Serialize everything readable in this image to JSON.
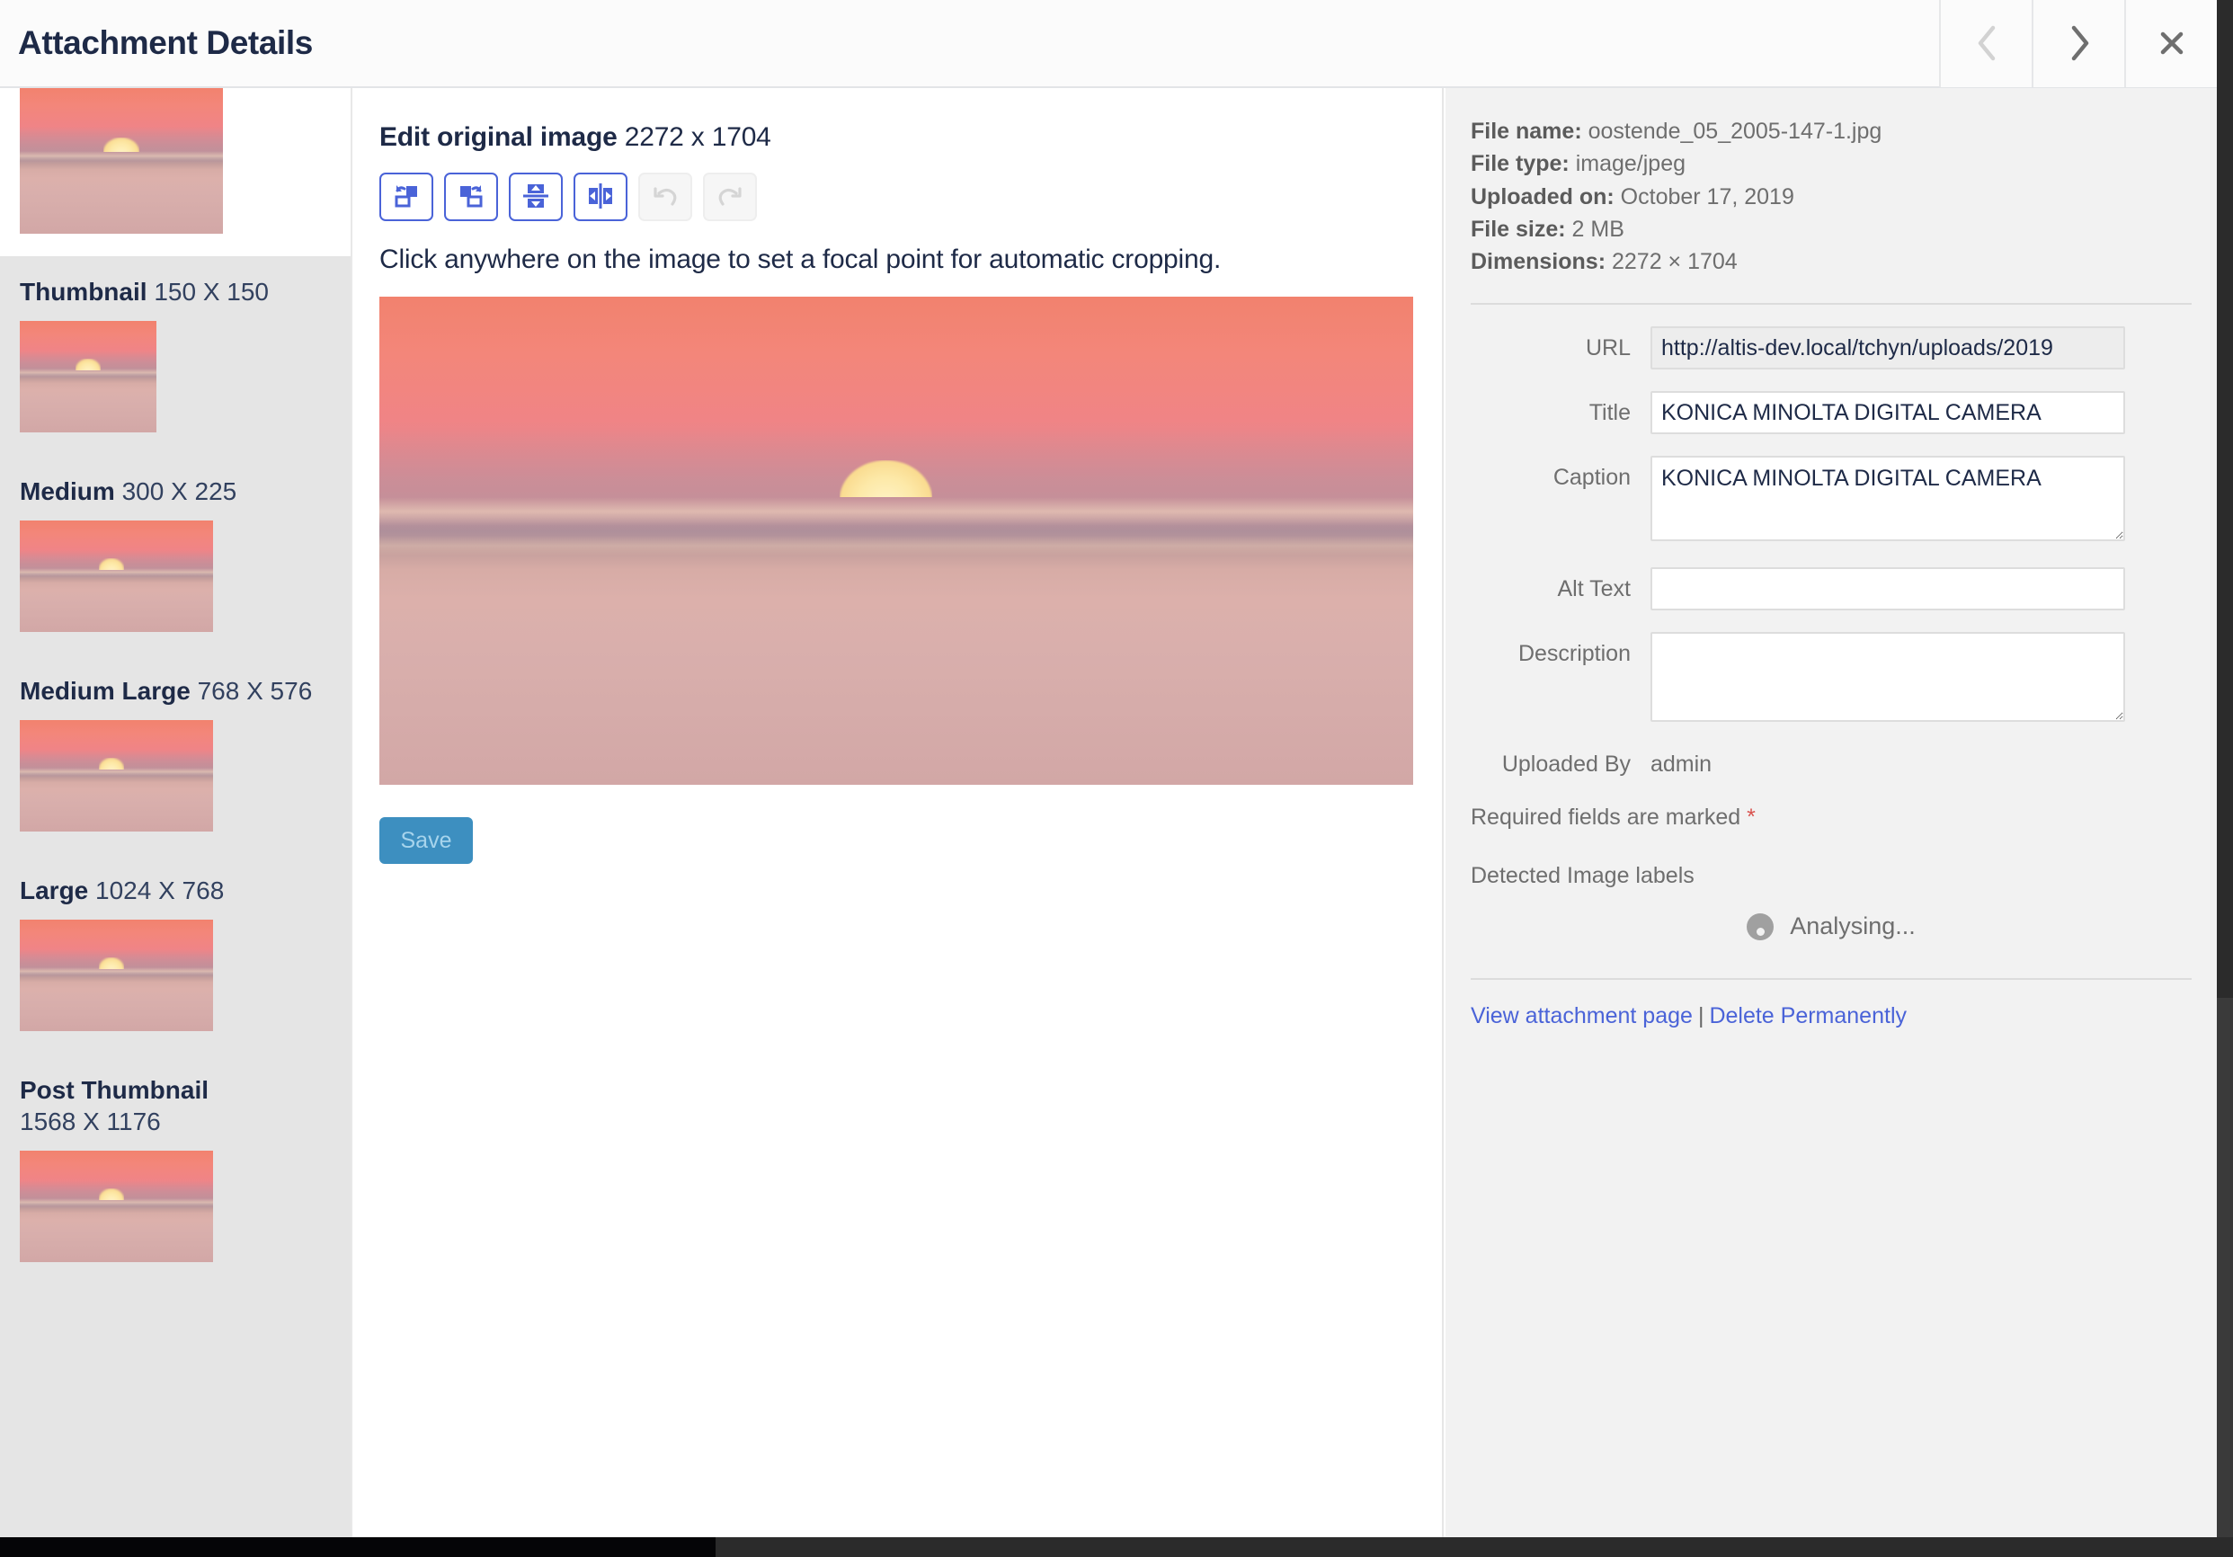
{
  "header": {
    "title": "Attachment Details",
    "prev_label": "Previous",
    "next_label": "Next",
    "close_label": "Close"
  },
  "sizes_sidebar": {
    "items": [
      {
        "name": "Thumbnail",
        "dimensions": "150 X 150",
        "wrap": false
      },
      {
        "name": "Medium",
        "dimensions": "300 X 225",
        "wrap": false
      },
      {
        "name": "Medium Large",
        "dimensions": "768 X 576",
        "wrap": false
      },
      {
        "name": "Large",
        "dimensions": "1024 X 768",
        "wrap": false
      },
      {
        "name": "Post Thumbnail",
        "dimensions": "1568 X 1176",
        "wrap": true
      }
    ]
  },
  "editor": {
    "heading": "Edit original image",
    "heading_dimensions": "2272 x 1704",
    "tools": [
      {
        "icon": "rotate-left-icon",
        "label": "Rotate left",
        "disabled": false
      },
      {
        "icon": "rotate-right-icon",
        "label": "Rotate right",
        "disabled": false
      },
      {
        "icon": "flip-vertical-icon",
        "label": "Flip vertical",
        "disabled": false
      },
      {
        "icon": "flip-horizontal-icon",
        "label": "Flip horizontal",
        "disabled": false
      },
      {
        "icon": "undo-icon",
        "label": "Undo",
        "disabled": true
      },
      {
        "icon": "redo-icon",
        "label": "Redo",
        "disabled": true
      }
    ],
    "focal_hint": "Click anywhere on the image to set a focal point for automatic cropping.",
    "save_label": "Save"
  },
  "details": {
    "meta": [
      {
        "label": "File name:",
        "value": "oostende_05_2005-147-1.jpg"
      },
      {
        "label": "File type:",
        "value": "image/jpeg"
      },
      {
        "label": "Uploaded on:",
        "value": "October 17, 2019"
      },
      {
        "label": "File size:",
        "value": "2 MB"
      },
      {
        "label": "Dimensions:",
        "value": "2272 × 1704"
      }
    ],
    "fields": {
      "url_label": "URL",
      "url_value": "http://altis-dev.local/tchyn/uploads/2019",
      "title_label": "Title",
      "title_value": "KONICA MINOLTA DIGITAL CAMERA",
      "caption_label": "Caption",
      "caption_value": "KONICA MINOLTA DIGITAL CAMERA",
      "alt_label": "Alt Text",
      "alt_value": "",
      "description_label": "Description",
      "description_value": "",
      "uploaded_by_label": "Uploaded By",
      "uploaded_by_value": "admin"
    },
    "required_note": "Required fields are marked ",
    "required_star": "*",
    "detected_labels_heading": "Detected Image labels",
    "analysing_text": "Analysing...",
    "view_link": "View attachment page",
    "link_separator": "|",
    "delete_link": "Delete Permanently"
  },
  "colors": {
    "accent_blue": "#4a63d8",
    "link_blue": "#4a63d8",
    "title_navy": "#1e2a47",
    "save_button": "#3d8fc0",
    "required_red": "#d9534f",
    "sidebar_bg": "#e5e5e5",
    "details_bg": "#f2f2f2"
  }
}
